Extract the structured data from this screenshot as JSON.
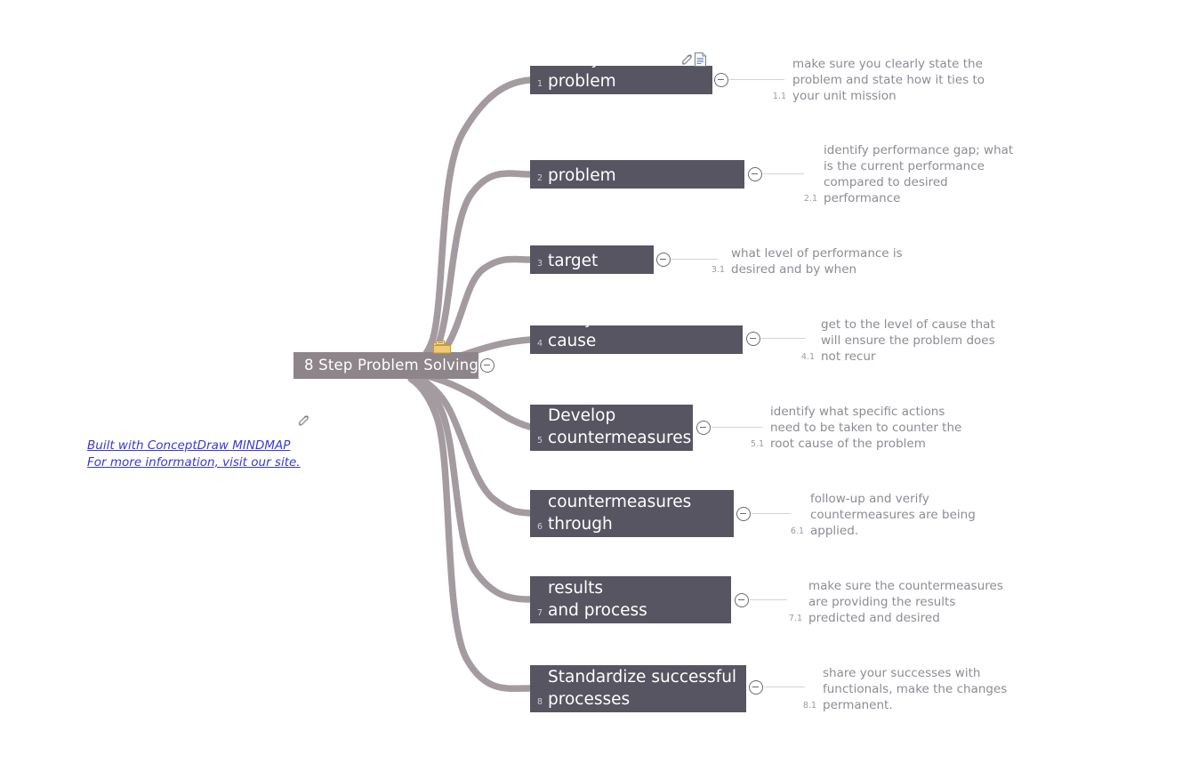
{
  "document": {
    "title": "8 Step Problem Solving",
    "type": "mind-map"
  },
  "colors": {
    "center_node_bg": "#8d8589",
    "topic_bg": "#565561",
    "branch": "#a39ba0",
    "subtopic_text": "#8d8b94",
    "subtopic_num": "#9b99a3",
    "connector": "#d4d2d6",
    "link": "#3a3ad0",
    "folder_icon": "#e9b94e",
    "page_bg": "#ffffff"
  },
  "center": {
    "label": "8 Step Problem Solving",
    "folder_icon_name": "folder-icon",
    "collapse_icon_name": "collapse-minus-icon"
  },
  "topics": [
    {
      "number": "1",
      "label": "Clarify the problem",
      "sub_number": "1.1",
      "sub_text": "make sure you clearly state the\nproblem and state how it ties to\nyour unit mission",
      "icons": [
        "paperclip-icon",
        "note-icon"
      ]
    },
    {
      "number": "2",
      "label": "Breakdown the problem",
      "sub_number": "2.1",
      "sub_text": "identify performance gap; what\nis the current performance\ncompared to desired\nperformance",
      "icons": []
    },
    {
      "number": "3",
      "label": "Set a target",
      "sub_number": "3.1",
      "sub_text": "what level of performance is\ndesired and by when",
      "icons": []
    },
    {
      "number": "4",
      "label": "Analyze the root cause",
      "sub_number": "4.1",
      "sub_text": "get to the level of cause that\nwill ensure the problem does\nnot recur",
      "icons": []
    },
    {
      "number": "5",
      "label": "Develop\ncountermeasures",
      "sub_number": "5.1",
      "sub_text": "identify what specific actions\nneed to be taken to counter the\nroot cause of the problem",
      "icons": []
    },
    {
      "number": "6",
      "label": "See countermeasures\nthrough",
      "sub_number": "6.1",
      "sub_text": "follow-up and verify\ncountermeasures are being\napplied.",
      "icons": []
    },
    {
      "number": "7",
      "label": "Evaluate both results\nand process",
      "sub_number": "7.1",
      "sub_text": "make sure the countermeasures\nare providing the results\npredicted and desired",
      "icons": []
    },
    {
      "number": "8",
      "label": "Standardize successful\nprocesses",
      "sub_number": "8.1",
      "sub_text": "share your successes with\nfunctionals, make the changes\npermanent.",
      "icons": []
    }
  ],
  "footer": {
    "line1": "Built with ConceptDraw MINDMAP",
    "line2": "For more information, visit our site.",
    "icon_name": "paperclip-icon"
  }
}
